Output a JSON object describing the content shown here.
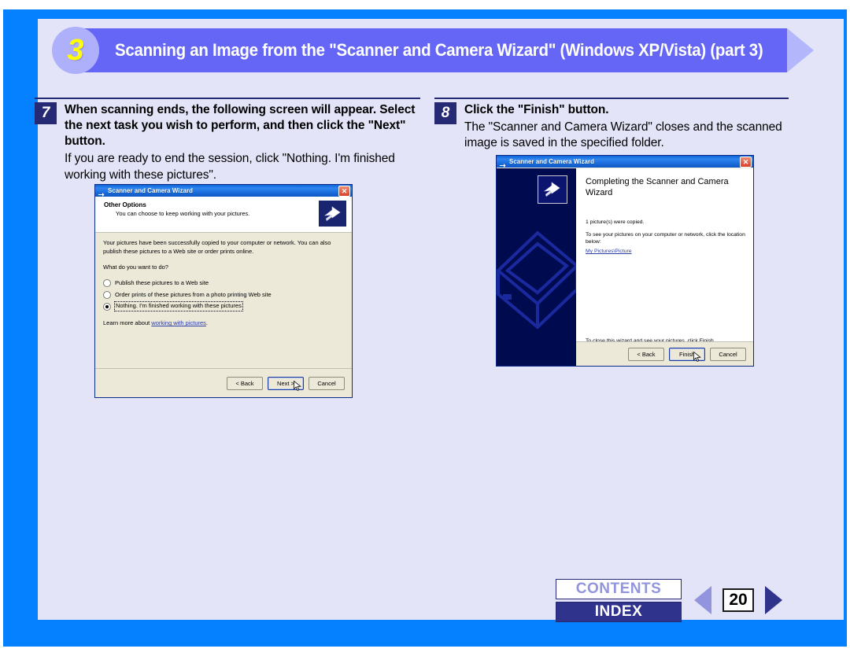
{
  "banner": {
    "step_number": "3",
    "title": "Scanning an Image from the \"Scanner and Camera Wizard\" (Windows XP/Vista) (part 3)"
  },
  "steps": [
    {
      "number": "7",
      "bold": "When scanning ends, the following screen will appear. Select the next task you wish to perform, and then click the \"Next\" button.",
      "normal": "If you are ready to end the session, click \"Nothing. I'm finished working with these pictures\"."
    },
    {
      "number": "8",
      "bold": "Click the \"Finish\" button.",
      "normal": "The \"Scanner and Camera Wizard\" closes and the scanned image is saved in the specified folder."
    }
  ],
  "dialog_other_options": {
    "titlebar": "Scanner and Camera Wizard",
    "close_label": "✕",
    "header_title": "Other Options",
    "header_subtitle": "You can choose to keep working with your pictures.",
    "paragraph": "Your pictures have been successfully copied to your computer or network. You can also publish these pictures to a Web site or order prints online.",
    "question": "What do you want to do?",
    "options": [
      {
        "label": "Publish these pictures to a Web site",
        "selected": false
      },
      {
        "label": "Order prints of these pictures from a photo printing Web site",
        "selected": false
      },
      {
        "label": "Nothing. I'm finished working with these pictures",
        "selected": true
      }
    ],
    "learn_more_prefix": "Learn more about ",
    "learn_more_link": "working with pictures",
    "learn_more_suffix": ".",
    "buttons": {
      "back": "< Back",
      "next": "Next >",
      "cancel": "Cancel"
    }
  },
  "dialog_completing": {
    "titlebar": "Scanner and Camera Wizard",
    "close_label": "✕",
    "heading": "Completing the Scanner and Camera Wizard",
    "copied_text": "1 picture(s) were copied.",
    "location_text": "To see your pictures on your computer or network, click the location below:",
    "location_link": "My Pictures\\Picture",
    "close_text": "To close this wizard and see your pictures, click Finish.",
    "buttons": {
      "back": "< Back",
      "finish": "Finish",
      "cancel": "Cancel"
    }
  },
  "footer": {
    "contents": "CONTENTS",
    "index": "INDEX",
    "page": "20"
  },
  "colors": {
    "frame_blue": "#0580ff",
    "panel": "#e3e4f7",
    "banner_bar": "#6566f5",
    "banner_circle": "#aeb0fb",
    "banner_number": "#ffff00",
    "navy": "#262a75",
    "xp_face": "#ece9d8",
    "link": "#2b3ea8"
  }
}
